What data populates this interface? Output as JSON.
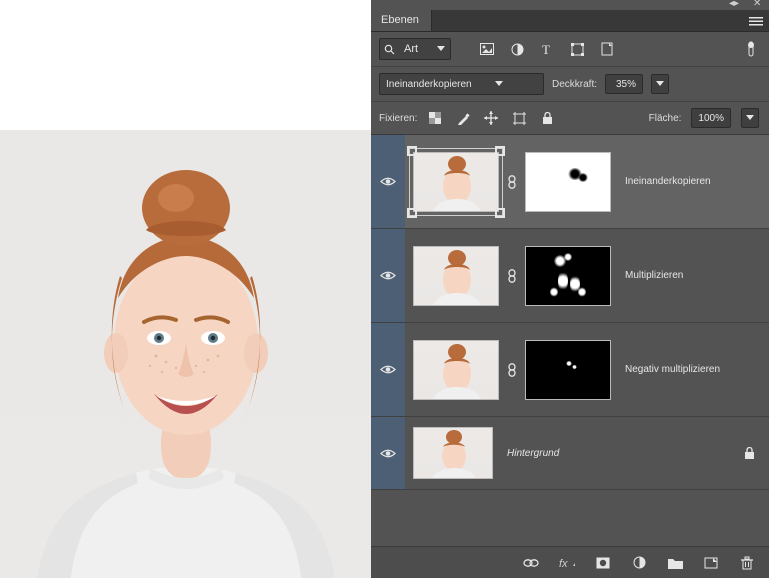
{
  "panel": {
    "tab_title": "Ebenen",
    "filter_label": "Art",
    "blend_mode": "Ineinanderkopieren",
    "opacity_label": "Deckkraft:",
    "opacity_value": "35%",
    "lock_label": "Fixieren:",
    "fill_label": "Fläche:",
    "fill_value": "100%"
  },
  "layers": [
    {
      "name": "Ineinanderkopieren",
      "selected": true,
      "has_mask": true,
      "mask_type": "light",
      "visible": true
    },
    {
      "name": "Multiplizieren",
      "selected": false,
      "has_mask": true,
      "mask_type": "dark_spread",
      "visible": true
    },
    {
      "name": "Negativ multiplizieren",
      "selected": false,
      "has_mask": true,
      "mask_type": "dark_dot",
      "visible": true
    },
    {
      "name": "Hintergrund",
      "selected": false,
      "has_mask": false,
      "background": true,
      "visible": true
    }
  ]
}
